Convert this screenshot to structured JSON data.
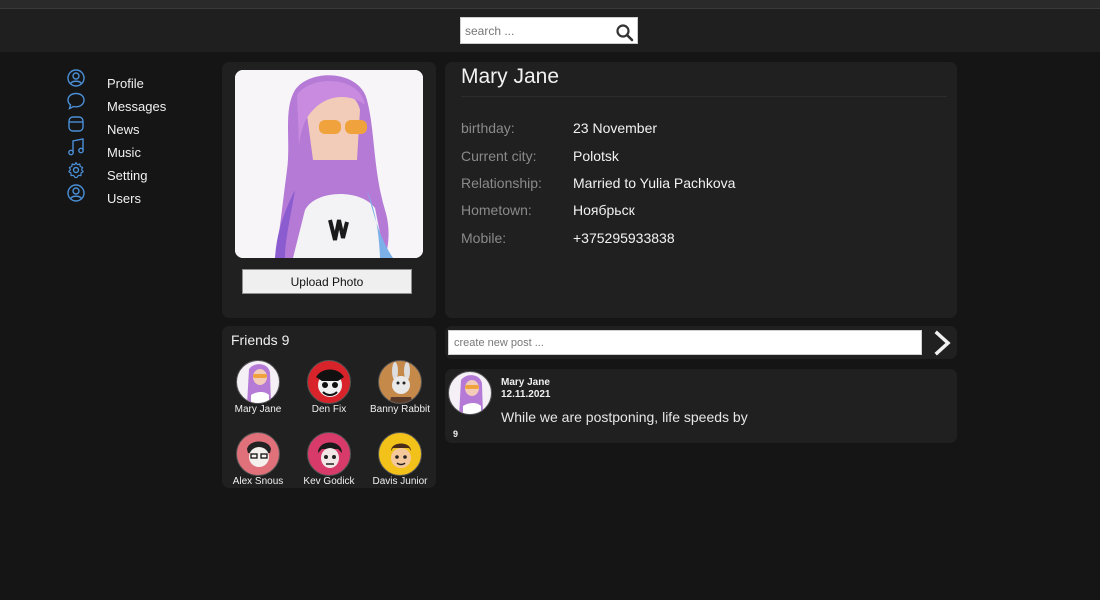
{
  "header": {
    "search_placeholder": "search ..."
  },
  "sidebar": {
    "items": [
      {
        "label": "Profile",
        "icon": "user-circle-icon"
      },
      {
        "label": "Messages",
        "icon": "chat-bubble-icon"
      },
      {
        "label": "News",
        "icon": "news-icon"
      },
      {
        "label": "Music",
        "icon": "music-note-icon"
      },
      {
        "label": "Setting",
        "icon": "gear-icon"
      },
      {
        "label": "Users",
        "icon": "users-icon"
      }
    ]
  },
  "profile": {
    "name": "Mary Jane",
    "upload_label": "Upload Photo",
    "info": [
      {
        "label": "birthday:",
        "value": "23 November"
      },
      {
        "label": "Current city:",
        "value": "Polotsk"
      },
      {
        "label": "Relationship:",
        "value": "Married to Yulia Pachkova"
      },
      {
        "label": "Hometown:",
        "value": "Ноябрьск"
      },
      {
        "label": "Mobile:",
        "value": "+375295933838"
      }
    ]
  },
  "friends": {
    "title": "Friends 9",
    "list": [
      {
        "name": "Mary Jane"
      },
      {
        "name": "Den Fix"
      },
      {
        "name": "Banny Rabbit"
      },
      {
        "name": "Alex Snous"
      },
      {
        "name": "Kev Godick"
      },
      {
        "name": "Davis Junior"
      }
    ]
  },
  "posts": {
    "new_post_placeholder": "create new post ...",
    "items": [
      {
        "author": "Mary Jane",
        "date": "12.11.2021",
        "text": "While we are postponing, life speeds by",
        "likes": "9"
      }
    ]
  },
  "colors": {
    "background": "#151515",
    "card": "#202020",
    "header": "#1f1f1f",
    "accent_icon": "#4a8fd8"
  }
}
